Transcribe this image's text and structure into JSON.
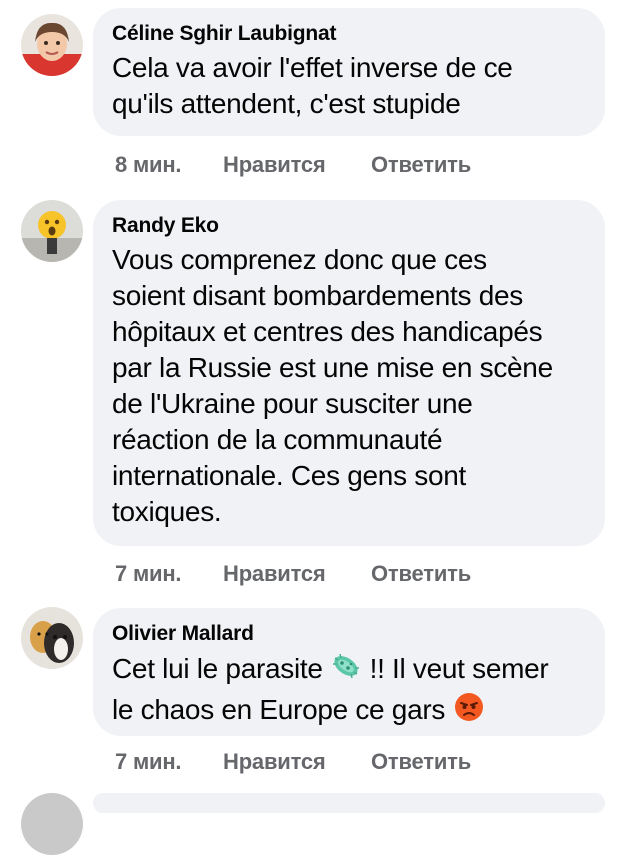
{
  "comments": [
    {
      "author": "Céline Sghir Laubignat",
      "text_lines": [
        "Cela va avoir l'effet inverse de ce",
        "qu'ils attendent, c'est stupide"
      ],
      "time": "8 мин.",
      "like": "Нравится",
      "reply": "Ответить"
    },
    {
      "author": "Randy Eko",
      "text_lines": [
        "Vous comprenez donc que ces",
        "soient disant bombardements des",
        "hôpitaux et centres des handicapés",
        "par la Russie est une mise en scène",
        "de l'Ukraine pour susciter une",
        "réaction de la communauté",
        "internationale. Ces gens sont",
        "toxiques."
      ],
      "time": "7 мин.",
      "like": "Нравится",
      "reply": "Ответить"
    },
    {
      "author": "Olivier Mallard",
      "text_line1_a": "Cet lui le parasite",
      "text_line1_b": "!! Il veut semer",
      "text_line2": "le chaos en Europe ce gars",
      "icons": [
        "microbe-emoji",
        "angry-face-emoji"
      ],
      "time": "7 мин.",
      "like": "Нравится",
      "reply": "Ответить"
    }
  ],
  "colors": {
    "bubble": "#f0f2f5",
    "text": "#050505",
    "meta": "#65676b"
  }
}
